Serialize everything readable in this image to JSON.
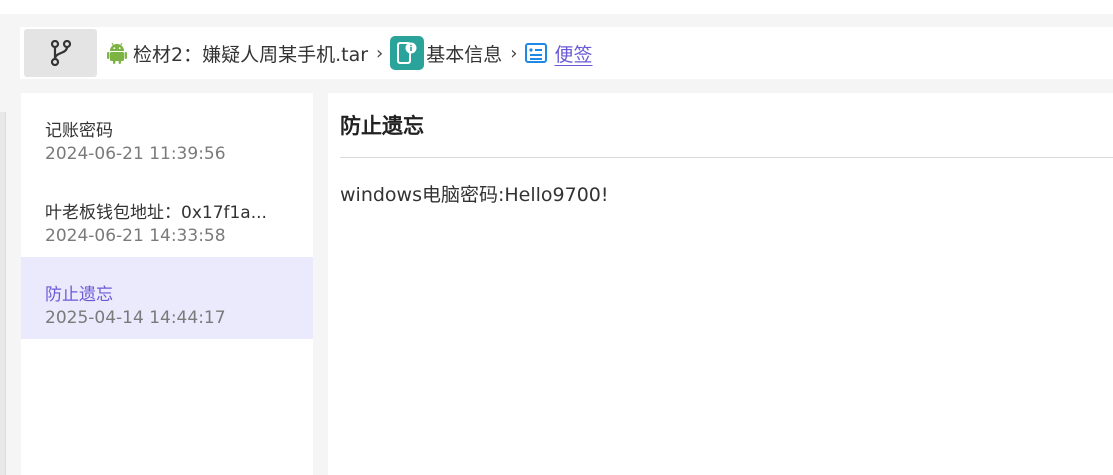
{
  "breadcrumb": {
    "branch_icon": "git-branch-icon",
    "evidence": {
      "icon": "android-icon",
      "label": "检材2：嫌疑人周某手机.tar"
    },
    "section": {
      "icon": "phone-info-icon",
      "label": "基本信息"
    },
    "current": {
      "icon": "note-icon",
      "label": "便签"
    },
    "separator": "›"
  },
  "notes": [
    {
      "title": "记账密码",
      "time": "2024-06-21 11:39:56"
    },
    {
      "title": "叶老板钱包地址：0x17f1a...",
      "time": "2024-06-21 14:33:58"
    },
    {
      "title": "防止遗忘",
      "time": "2025-04-14 14:44:17"
    }
  ],
  "selected_index": 2,
  "detail": {
    "title": "防止遗忘",
    "content": "windows电脑密码:Hello9700!"
  },
  "colors": {
    "accent": "#6b5ad6",
    "selected_bg": "#ebe9fc",
    "android": "#7cb342",
    "info_icon_bg": "#2aa39a",
    "note_icon": "#1e88e5"
  }
}
